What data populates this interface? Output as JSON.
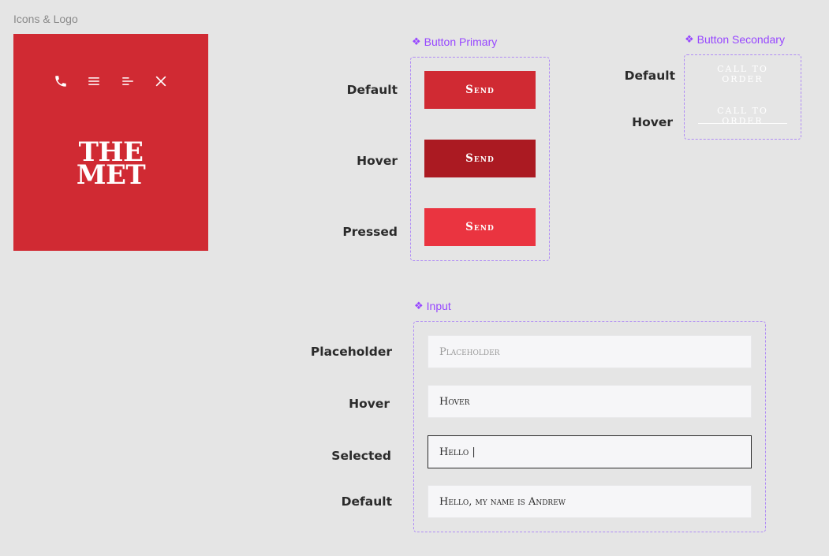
{
  "frame": {
    "title": "Icons & Logo"
  },
  "logo_card": {
    "background": "#d02a33",
    "icons": [
      "phone-icon",
      "hamburger-menu-icon",
      "align-left-lines-icon",
      "close-icon"
    ],
    "logo_line1": "THE",
    "logo_line2": "MET"
  },
  "button_primary": {
    "set_label": "Button Primary",
    "states": [
      {
        "state": "Default",
        "label": "Send",
        "color": "#d02a33"
      },
      {
        "state": "Hover",
        "label": "Send",
        "color": "#ab1a22"
      },
      {
        "state": "Pressed",
        "label": "Send",
        "color": "#ea3440"
      }
    ]
  },
  "button_secondary": {
    "set_label": "Button Secondary",
    "states": [
      {
        "state": "Default",
        "label": "call to order"
      },
      {
        "state": "Hover",
        "label": "call to order"
      }
    ]
  },
  "input": {
    "set_label": "Input",
    "states": [
      {
        "state": "Placeholder",
        "placeholder": "Placeholder"
      },
      {
        "state": "Hover",
        "value": "Hover"
      },
      {
        "state": "Selected",
        "value": "Hello |"
      },
      {
        "state": "Default",
        "value": "Hello, my name is Andrew"
      }
    ]
  },
  "accent_color": "#9747ff"
}
